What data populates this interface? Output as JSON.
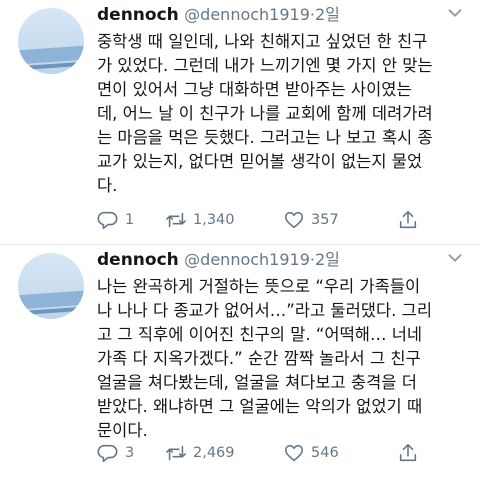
{
  "tweets": [
    {
      "name": "dennoch",
      "handle": "@dennoch1919",
      "separator": "·",
      "time": "2일",
      "lines": [
        "중학생 때 일인데, 나와 친해지고 싶었던 한 친구",
        "가 있었다. 그런데 내가 느끼기엔 몇 가지 안 맞는",
        "면이 있어서 그냥 대화하면 받아주는 사이였는",
        "데, 어느 날 이 친구가 나를 교회에 함께 데려가려",
        "는 마음을 먹은 듯했다. 그러고는 나 보고 혹시 종",
        "교가 있는지, 없다면 믿어볼 생각이 없는지 물었",
        "다."
      ],
      "replies": "1",
      "retweets": "1,340",
      "likes": "357"
    },
    {
      "name": "dennoch",
      "handle": "@dennoch1919",
      "separator": "·",
      "time": "2일",
      "lines": [
        "나는 완곡하게 거절하는 뜻으로 “우리 가족들이",
        "나 나나 다 종교가 없어서…”라고 둘러댔다. 그리",
        "고 그 직후에 이어진 친구의 말. “어떡해… 너네",
        "가족 다 지옥가겠다.” 순간 깜짝 놀라서 그 친구",
        "얼굴을 쳐다봤는데, 얼굴을 쳐다보고 충격을 더",
        "받았다. 왜냐하면 그 얼굴에는 악의가 없었기 때",
        "문이다."
      ],
      "replies": "3",
      "retweets": "2,469",
      "likes": "546"
    }
  ],
  "icons": {
    "reply": "reply-icon",
    "retweet": "retweet-icon",
    "like": "heart-icon",
    "share": "share-icon",
    "menu": "chevron-down-icon"
  },
  "colors": {
    "text": "#14171a",
    "secondary": "#657786",
    "divider": "#e1e8ed"
  }
}
